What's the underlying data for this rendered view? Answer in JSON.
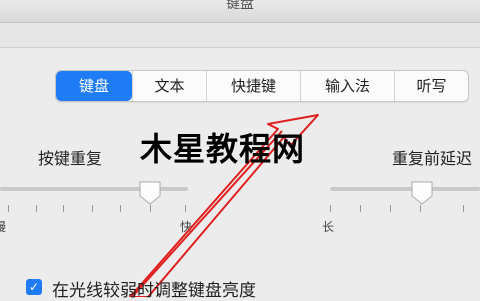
{
  "window": {
    "title": "键盘"
  },
  "tabs": [
    {
      "label": "键盘",
      "active": true
    },
    {
      "label": "文本",
      "active": false
    },
    {
      "label": "快捷键",
      "active": false
    },
    {
      "label": "输入法",
      "active": false
    },
    {
      "label": "听写",
      "active": false
    }
  ],
  "key_repeat": {
    "label": "按键重复",
    "min_label": "慢",
    "max_label": "快"
  },
  "delay_until_repeat": {
    "label": "重复前延迟",
    "min_label": "长"
  },
  "watermark": {
    "text": "木星教程网"
  },
  "backlight_checkbox": {
    "label": "在光线较弱时调整键盘亮度",
    "checked": true
  },
  "colors": {
    "accent": "#1f7cf6",
    "arrow": "#e02020"
  }
}
